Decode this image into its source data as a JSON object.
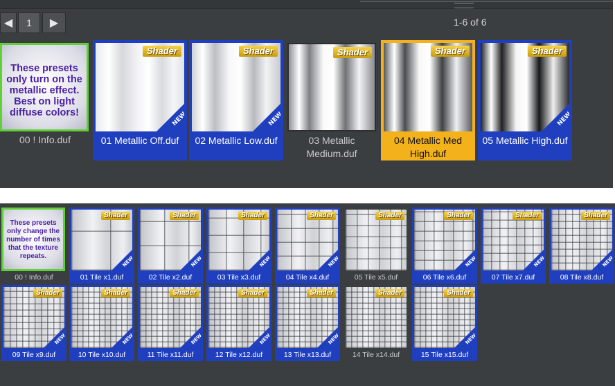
{
  "panel1": {
    "page_number": "1",
    "range_label": "1-6 of 6",
    "info_text": "These presets only turn on the metallic effect. Best on light diffuse colors!",
    "badge_label": "Shader",
    "new_label": "NEW",
    "tiles": [
      {
        "label": "00 ! Info.duf"
      },
      {
        "label": "01 Metallic Off.duf"
      },
      {
        "label": "02 Metallic Low.duf"
      },
      {
        "label": "03 Metallic Medium.duf"
      },
      {
        "label": "04 Metallic Med High.duf"
      },
      {
        "label": "05 Metallic High.duf"
      }
    ]
  },
  "panel2": {
    "info_text": "These presets only change the number of times that the texture repeats.",
    "badge_label": "Shader",
    "new_label": "NEW",
    "tiles": [
      {
        "label": "00 ! Info.duf"
      },
      {
        "label": "01 Tile x1.duf"
      },
      {
        "label": "02 Tile x2.duf"
      },
      {
        "label": "03 Tile x3.duf"
      },
      {
        "label": "04 Tile x4.duf"
      },
      {
        "label": "05 Tile x5.duf"
      },
      {
        "label": "06 Tile x6.duf"
      },
      {
        "label": "07 Tile x7.duf"
      },
      {
        "label": "08 Tile x8.duf"
      },
      {
        "label": "09 Tile x9.duf"
      },
      {
        "label": "10 Tile x10.duf"
      },
      {
        "label": "11 Tile x11.duf"
      },
      {
        "label": "12 Tile x12.duf"
      },
      {
        "label": "13 Tile x13.duf"
      },
      {
        "label": "14 Tile x14.duf"
      },
      {
        "label": "15 Tile x15.duf"
      }
    ]
  },
  "colors": {
    "panel_bg": "#3b3e41",
    "selected_blue": "#1f3fbf",
    "active_orange": "#f3b21c",
    "info_green": "#5fd132",
    "info_text": "#4b1fa3"
  }
}
